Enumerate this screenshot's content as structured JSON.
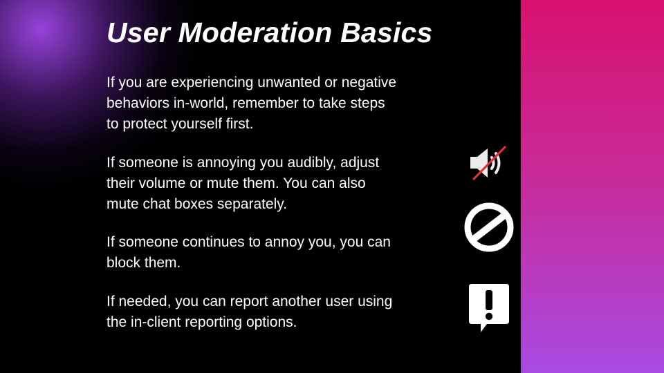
{
  "slide": {
    "title": "User Moderation Basics",
    "paragraphs": [
      {
        "lines": [
          "If you are experiencing unwanted or negative",
          "behaviors in-world, remember to take steps",
          "to protect yourself first."
        ]
      },
      {
        "lines": [
          "If someone is annoying you audibly, adjust",
          "their volume or mute them.  You can also",
          "mute chat boxes separately."
        ]
      },
      {
        "lines": [
          "If someone continues to annoy you, you can",
          "block them."
        ]
      },
      {
        "lines": [
          "If needed, you can report another user using",
          "the in-client reporting options."
        ]
      }
    ],
    "icons": [
      "speaker-muted-icon",
      "block-icon",
      "report-icon"
    ]
  },
  "colors": {
    "background": "#000000",
    "text": "#ffffff",
    "sidebar_gradient_top": "#d8116e",
    "sidebar_gradient_bottom": "#a84be3",
    "mute_slash": "#e0303a",
    "glow": "#a046e6"
  }
}
